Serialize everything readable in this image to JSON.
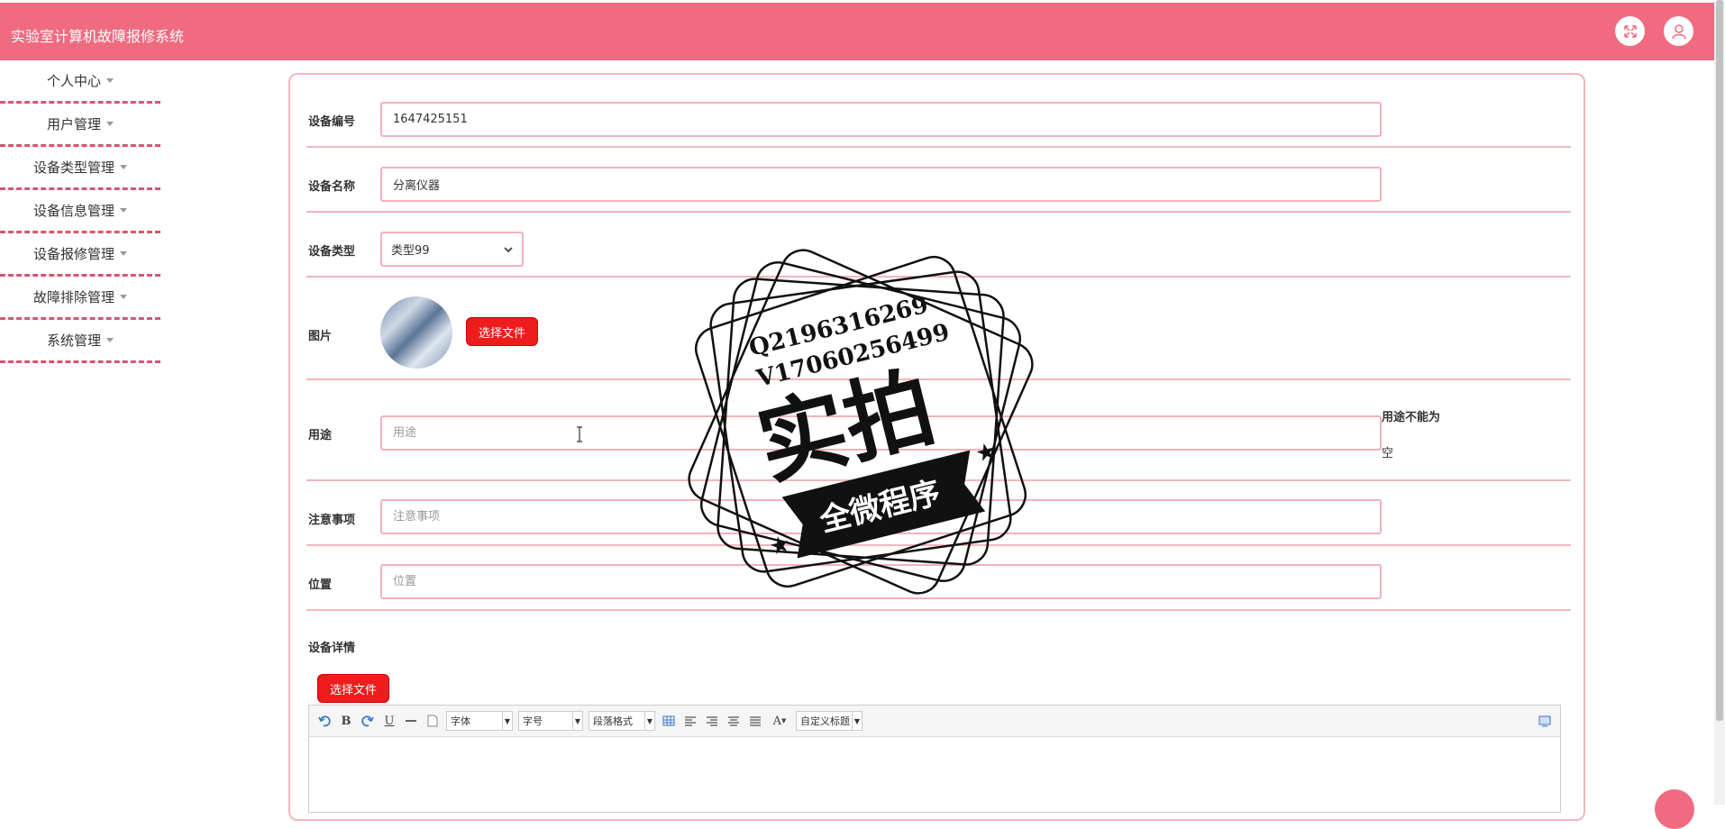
{
  "header": {
    "title": "实验室计算机故障报修系统",
    "bg_color": "#f06a80"
  },
  "sidebar": {
    "items": [
      {
        "label": "个人中心"
      },
      {
        "label": "用户管理"
      },
      {
        "label": "设备类型管理"
      },
      {
        "label": "设备信息管理"
      },
      {
        "label": "设备报修管理"
      },
      {
        "label": "故障排除管理"
      },
      {
        "label": "系统管理"
      }
    ]
  },
  "form": {
    "device_no": {
      "label": "设备编号",
      "value": "1647425151"
    },
    "device_name": {
      "label": "设备名称",
      "value": "分离仪器"
    },
    "device_type": {
      "label": "设备类型",
      "value": "类型99"
    },
    "image": {
      "label": "图片",
      "button": "选择文件"
    },
    "usage": {
      "label": "用途",
      "placeholder": "用途",
      "error_line1": "用途不能为",
      "error_line2": "空"
    },
    "notes": {
      "label": "注意事项",
      "placeholder": "注意事项"
    },
    "location": {
      "label": "位置",
      "placeholder": "位置"
    },
    "details": {
      "label": "设备详情",
      "button": "选择文件"
    }
  },
  "editor": {
    "font_combo": "字体",
    "size_combo": "字号",
    "para_combo": "段落格式",
    "custom_combo": "自定义标题"
  },
  "watermark": {
    "line1": "Q2196316269",
    "line2": "V17060256499",
    "main": "实拍",
    "banner": "全微程序"
  }
}
